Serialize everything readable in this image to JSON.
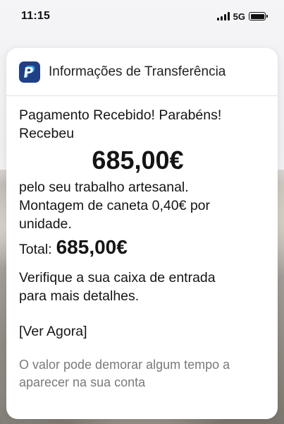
{
  "status_bar": {
    "time": "11:15",
    "network": "5G",
    "icons": [
      "signal-icon",
      "battery-icon"
    ]
  },
  "notification": {
    "app_icon": "paypal-icon",
    "header_title": "Informações de Transferência",
    "lines": {
      "line1": "Pagamento Recebido! Parabéns!",
      "line2": "Recebeu",
      "amount": "685,00€",
      "line3": "pelo seu trabalho artesanal.",
      "line4": "Montagem de caneta 0,40€ por",
      "line5": "unidade."
    },
    "total_label": "Total:",
    "total_value": "685,00€",
    "details_line1": "Verifique a sua caixa de entrada",
    "details_line2": "para mais detalhes.",
    "cta": "[Ver Agora]",
    "footnote_line1": "O valor pode demorar algum tempo a",
    "footnote_line2": "aparecer na sua conta"
  },
  "colors": {
    "icon_bg": "#1f3f86",
    "card_bg": "#ffffff",
    "muted_text": "#7a7a7e"
  }
}
